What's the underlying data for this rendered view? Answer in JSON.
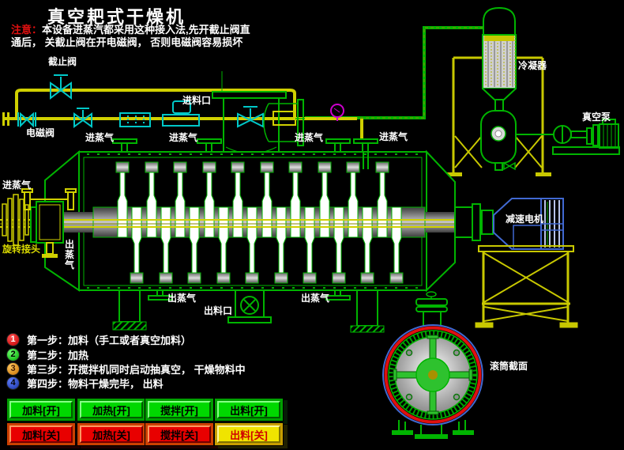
{
  "title": "真空耙式干燥机",
  "notice": {
    "prefix": "注意：",
    "line1": "本设备进蒸汽都采用这种接入法,先开截止阀直",
    "line2": "通后， 关截止阀在开电磁阀， 否则电磁阀容易损坏"
  },
  "labels": {
    "stop_valve": "截止阀",
    "solenoid_valve": "电磁阀",
    "feed_port": "进料口",
    "steam_in": "进蒸气",
    "steam_out": "出蒸气",
    "rotary_joint": "旋转接头",
    "discharge_port": "出料口",
    "condenser": "冷凝器",
    "vacuum_pump": "真空泵",
    "gear_motor": "减速电机",
    "drum_section": "滚筒截面"
  },
  "steps": [
    {
      "num": "1",
      "text": "第一步：加料（手工或者真空加料）"
    },
    {
      "num": "2",
      "text": "第二步：加热"
    },
    {
      "num": "3",
      "text": "第三步：开搅拌机同时启动抽真空， 干燥物料中"
    },
    {
      "num": "4",
      "text": "第四步：物料干燥完毕， 出料"
    }
  ],
  "buttons": [
    {
      "label": "加料[开]",
      "state": "on"
    },
    {
      "label": "加热[开]",
      "state": "on"
    },
    {
      "label": "搅拌[开]",
      "state": "on"
    },
    {
      "label": "出料[开]",
      "state": "on"
    },
    {
      "label": "加料[关]",
      "state": "off"
    },
    {
      "label": "加热[关]",
      "state": "off"
    },
    {
      "label": "搅拌[关]",
      "state": "off"
    },
    {
      "label": "出料[关]",
      "state": "off-yellow"
    }
  ],
  "colors": {
    "machine_green": "#00b400",
    "pipe_yellow": "#d0d000",
    "valve_cyan": "#00c8c8",
    "gauge_magenta": "#cc00cc",
    "motor_blue": "#4169d2",
    "notice_red": "#e01010",
    "button_on_green": "#00d800",
    "button_off_red": "#e80000",
    "button_discharge_off_yellow": "#f0e400",
    "title_white": "#ffffff"
  }
}
